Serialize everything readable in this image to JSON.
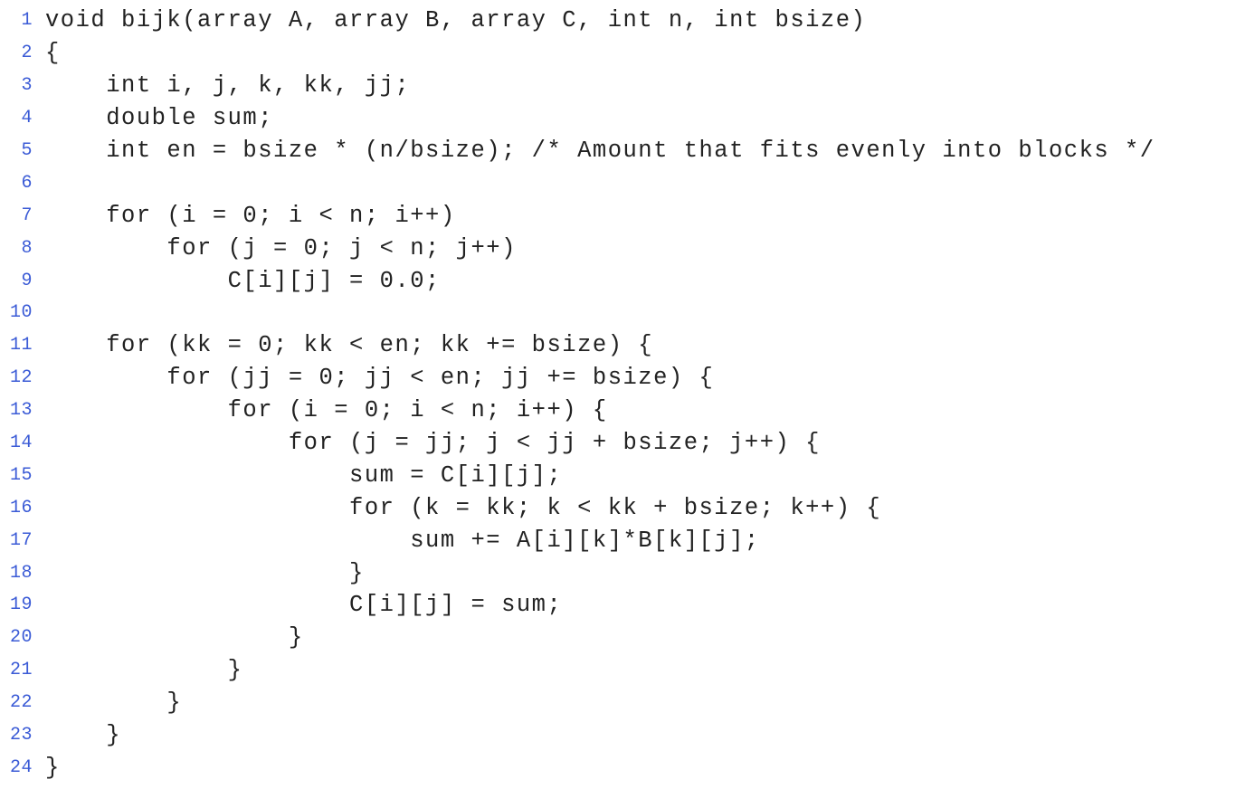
{
  "code": {
    "lines": [
      {
        "number": "1",
        "text": "void bijk(array A, array B, array C, int n, int bsize)"
      },
      {
        "number": "2",
        "text": "{"
      },
      {
        "number": "3",
        "text": "    int i, j, k, kk, jj;"
      },
      {
        "number": "4",
        "text": "    double sum;"
      },
      {
        "number": "5",
        "text": "    int en = bsize * (n/bsize); /* Amount that fits evenly into blocks */"
      },
      {
        "number": "6",
        "text": ""
      },
      {
        "number": "7",
        "text": "    for (i = 0; i < n; i++)"
      },
      {
        "number": "8",
        "text": "        for (j = 0; j < n; j++)"
      },
      {
        "number": "9",
        "text": "            C[i][j] = 0.0;"
      },
      {
        "number": "10",
        "text": ""
      },
      {
        "number": "11",
        "text": "    for (kk = 0; kk < en; kk += bsize) {"
      },
      {
        "number": "12",
        "text": "        for (jj = 0; jj < en; jj += bsize) {"
      },
      {
        "number": "13",
        "text": "            for (i = 0; i < n; i++) {"
      },
      {
        "number": "14",
        "text": "                for (j = jj; j < jj + bsize; j++) {"
      },
      {
        "number": "15",
        "text": "                    sum = C[i][j];"
      },
      {
        "number": "16",
        "text": "                    for (k = kk; k < kk + bsize; k++) {"
      },
      {
        "number": "17",
        "text": "                        sum += A[i][k]*B[k][j];"
      },
      {
        "number": "18",
        "text": "                    }"
      },
      {
        "number": "19",
        "text": "                    C[i][j] = sum;"
      },
      {
        "number": "20",
        "text": "                }"
      },
      {
        "number": "21",
        "text": "            }"
      },
      {
        "number": "22",
        "text": "        }"
      },
      {
        "number": "23",
        "text": "    }"
      },
      {
        "number": "24",
        "text": "}"
      }
    ]
  }
}
